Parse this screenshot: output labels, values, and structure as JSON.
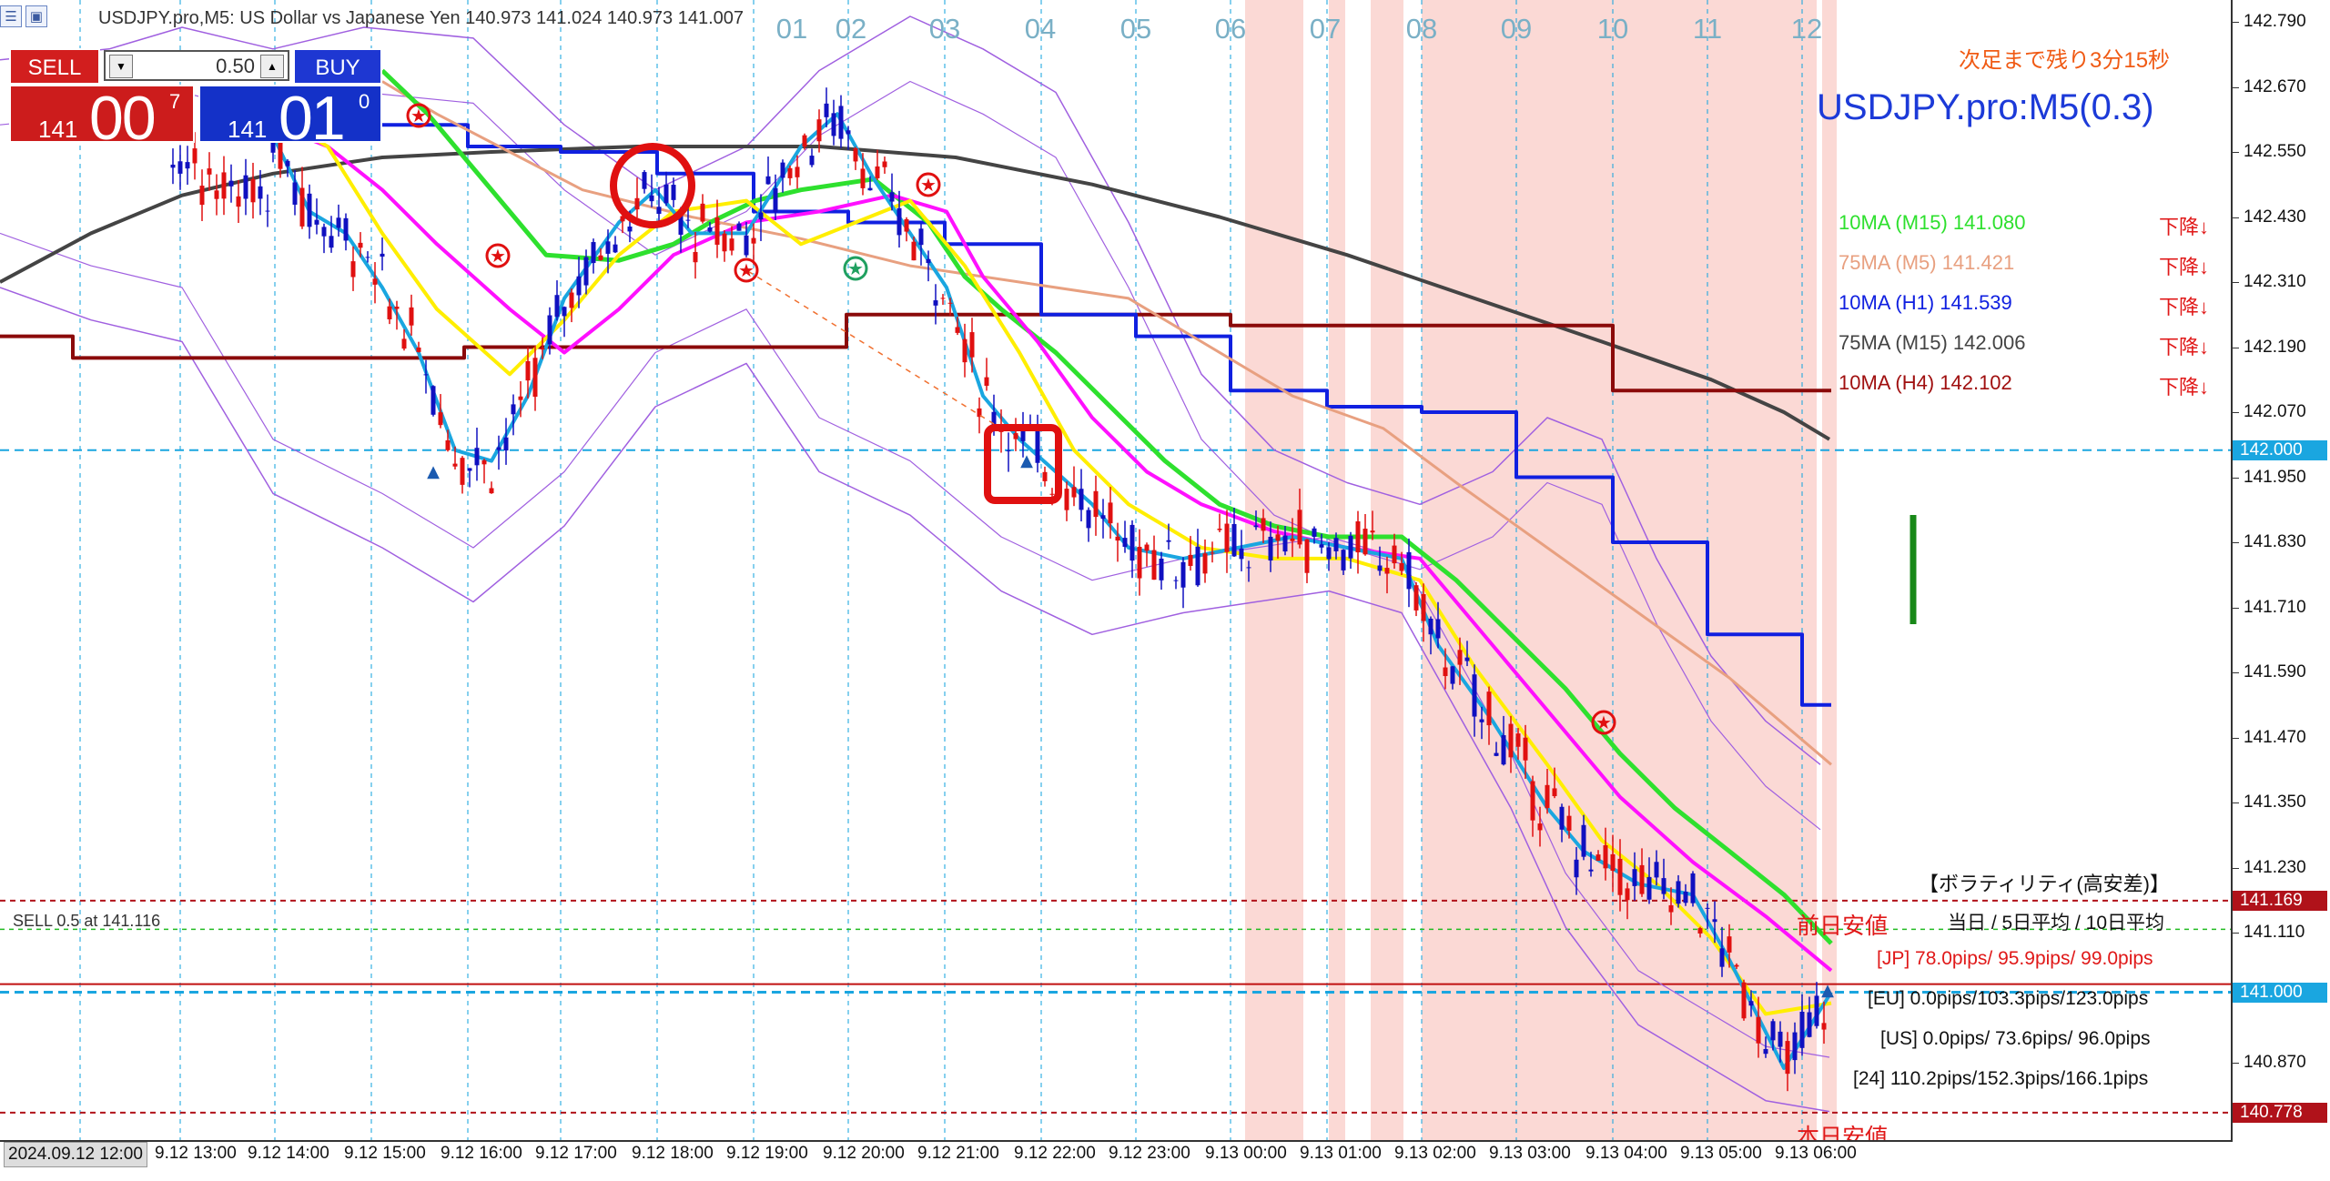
{
  "window": {
    "symbol_line": "USDJPY.pro,M5: US Dollar vs Japanese Yen  140.973 141.024 140.973 141.007"
  },
  "trade_panel": {
    "sell_label": "SELL",
    "buy_label": "BUY",
    "lot": "0.50",
    "bid": {
      "prefix": "141",
      "big": "00",
      "sup": "7"
    },
    "ask": {
      "prefix": "141",
      "big": "01",
      "sup": "0"
    }
  },
  "countdown": "次足まで残り3分15秒",
  "big_symbol": "USDJPY.pro:M5(0.3)",
  "ma_panel": [
    {
      "label": "10MA (M15) 141.080",
      "trend": "下降↓",
      "color": "#2ee02e"
    },
    {
      "label": "75MA (M5)  141.421",
      "trend": "下降↓",
      "color": "#e8a080"
    },
    {
      "label": "10MA (H1)  141.539",
      "trend": "下降↓",
      "color": "#1020e0"
    },
    {
      "label": "75MA (M15) 142.006",
      "trend": "下降↓",
      "color": "#444444"
    },
    {
      "label": "10MA (H4)  142.102",
      "trend": "下降↓",
      "color": "#a01010"
    }
  ],
  "volatility": {
    "title": "【ボラティリティ(高安差)】",
    "header": "当日 / 5日平均 / 10日平均",
    "rows": [
      {
        "text": "[JP] 78.0pips/ 95.9pips/ 99.0pips",
        "color": "#e01818"
      },
      {
        "text": "[EU]  0.0pips/103.3pips/123.0pips",
        "color": "#111111"
      },
      {
        "text": "[US]  0.0pips/ 73.6pips/ 96.0pips",
        "color": "#111111"
      },
      {
        "text": "[24] 110.2pips/152.3pips/166.1pips",
        "color": "#111111"
      }
    ]
  },
  "labels": {
    "prev_low": "前日安値",
    "today_low": "本日安値",
    "sell_order": "SELL 0.5 at 141.116"
  },
  "hour_labels": [
    "01",
    "02",
    "03",
    "04",
    "05",
    "06",
    "07",
    "08",
    "09",
    "10",
    "11",
    "12"
  ],
  "price_axis": [
    "142.790",
    "142.670",
    "142.550",
    "142.430",
    "142.310",
    "142.190",
    "142.070",
    "141.950",
    "141.830",
    "141.710",
    "141.590",
    "141.470",
    "141.350",
    "141.230",
    "141.110",
    "140.870"
  ],
  "price_markers": [
    {
      "value": "142.000",
      "price": 142.0,
      "color": "#1aa6e0"
    },
    {
      "value": "141.169",
      "price": 141.169,
      "color": "#b0121a"
    },
    {
      "value": "141.000",
      "price": 141.0,
      "color": "#1aa6e0"
    },
    {
      "value": "140.778",
      "price": 140.778,
      "color": "#b0121a"
    }
  ],
  "time_axis": [
    "2024.09.12 12:00",
    "9.12 13:00",
    "9.12 14:00",
    "9.12 15:00",
    "9.12 16:00",
    "9.12 17:00",
    "9.12 18:00",
    "9.12 19:00",
    "9.12 20:00",
    "9.12 21:00",
    "9.12 22:00",
    "9.12 23:00",
    "9.13 00:00",
    "9.13 01:00",
    "9.13 02:00",
    "9.13 03:00",
    "9.13 04:00",
    "9.13 05:00",
    "9.13 06:00"
  ],
  "colors": {
    "ma_m15_10": "#2ee02e",
    "ma_m5_75": "#e8a080",
    "ma_h1_10": "#1020e0",
    "ma_m15_75": "#444444",
    "ma_h4_10": "#8b0a0a",
    "magenta": "#ff10ff",
    "yellow": "#ffee00",
    "cyan": "#1aa6e0",
    "bollinger": "#a060e0",
    "session": "#fbd9d5"
  }
}
